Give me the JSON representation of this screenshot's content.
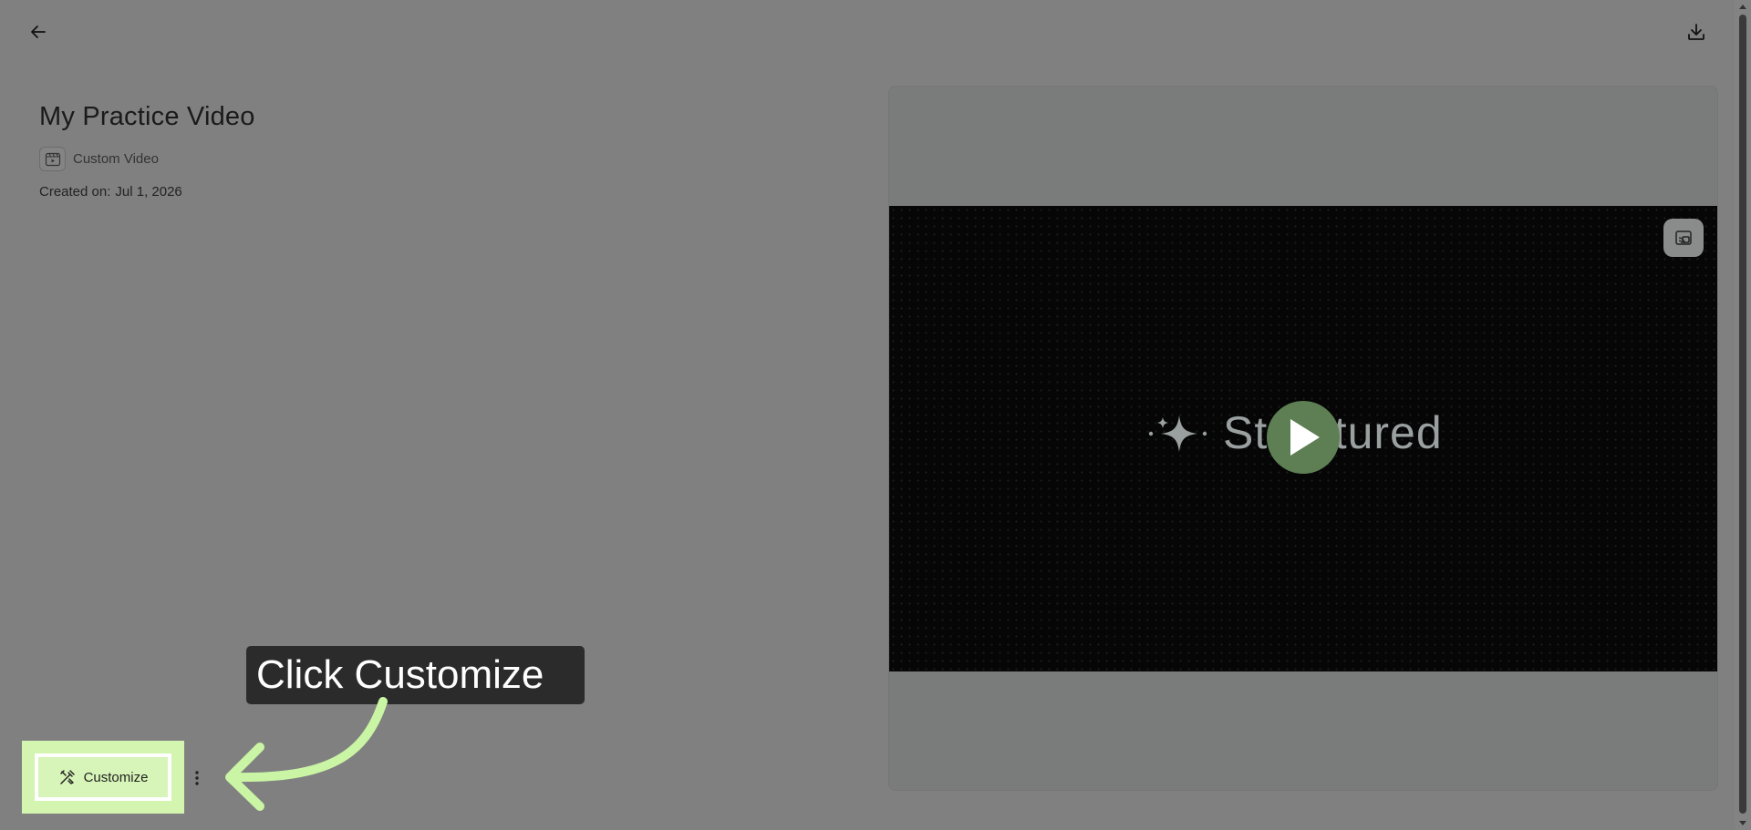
{
  "video": {
    "title": "My Practice Video",
    "type_label": "Custom Video",
    "created_label": "Created on:",
    "created_date": "Jul 1, 2026",
    "brand_text": "Structured"
  },
  "actions": {
    "customize_label": "Customize"
  },
  "tutorial": {
    "callout_text": "Click Customize"
  },
  "icons": {
    "back": "arrow-left-icon",
    "download": "download-icon",
    "video_type": "video-file-icon",
    "play": "play-icon",
    "pip": "picture-in-picture-icon",
    "customize": "customize-tools-icon",
    "more": "more-vertical-icon"
  },
  "colors": {
    "overlay_bg": "#808080",
    "highlight": "#d3f5b0",
    "arrow": "#c9f5a5",
    "play_button": "#5e7e54",
    "callout_bg": "#2b2b2b"
  }
}
